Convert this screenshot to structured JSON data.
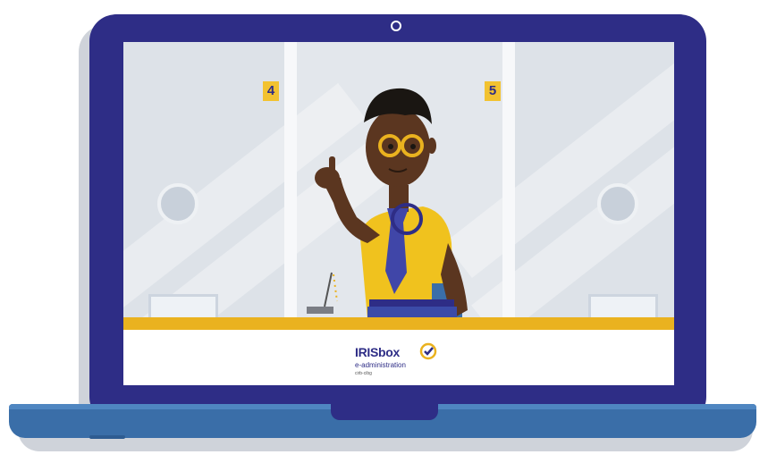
{
  "booths": {
    "left_number": "4",
    "right_number": "5"
  },
  "logo": {
    "name": "IRISbox",
    "subtitle": "e-administration",
    "tagline": "cirb-cibg"
  },
  "colors": {
    "frame": "#2e2d86",
    "base": "#3a6ea8",
    "accent_yellow": "#eab21f",
    "skin": "#5b3620"
  }
}
